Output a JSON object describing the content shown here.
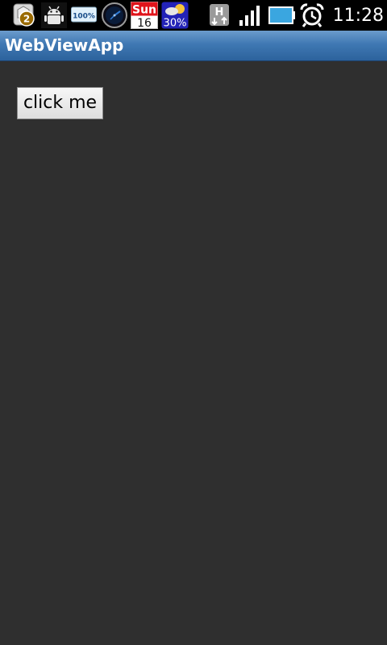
{
  "status_bar": {
    "notification_count": "2",
    "battery_widget_text": "100%",
    "calendar": {
      "day_name": "Sun",
      "day_number": "16"
    },
    "weather_percent": "30%",
    "network_type": "H",
    "time": "11:28",
    "icons": [
      "notification-badge-icon",
      "android-debug-icon",
      "battery-widget-icon",
      "clock-widget-icon",
      "calendar-icon",
      "weather-icon",
      "hspa-data-icon",
      "signal-strength-icon",
      "battery-icon",
      "alarm-clock-icon"
    ]
  },
  "app": {
    "title": "WebViewApp"
  },
  "content": {
    "button_label": "click me"
  },
  "colors": {
    "status_bar_bg": "#000000",
    "title_bar": "#3f78b3",
    "content_bg": "#2f2f2f",
    "battery_fill": "#3aa6e0"
  }
}
